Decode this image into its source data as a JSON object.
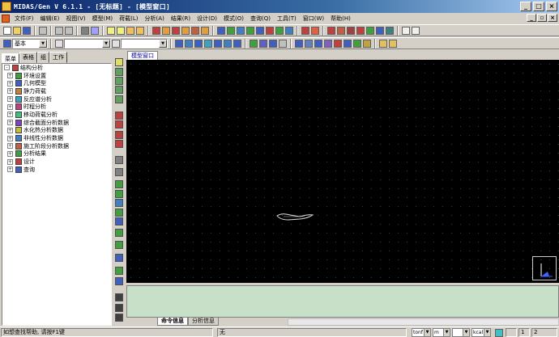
{
  "window": {
    "title": "MIDAS/Gen V 6.1.1 - [无标题] - [模型窗口]"
  },
  "menu": {
    "items": [
      "文件(F)",
      "编辑(E)",
      "视图(V)",
      "模型(M)",
      "荷载(L)",
      "分析(A)",
      "结果(R)",
      "设计(D)",
      "模式(O)",
      "查询(Q)",
      "工具(T)",
      "窗口(W)",
      "帮助(H)"
    ]
  },
  "toolbar2": {
    "unit_combo": "基本",
    "node_combo": ""
  },
  "left_panel": {
    "tabs": [
      "菜单",
      "表格",
      "组",
      "工作"
    ],
    "tree": [
      {
        "label": "结构分析",
        "level": 0,
        "expander": "-",
        "icon_color": "#c04040"
      },
      {
        "label": "环境设置",
        "level": 1,
        "expander": "+",
        "icon_color": "#40a040"
      },
      {
        "label": "几何模型",
        "level": 1,
        "expander": "+",
        "icon_color": "#4060c0"
      },
      {
        "label": "静力荷载",
        "level": 1,
        "expander": "+",
        "icon_color": "#c08040"
      },
      {
        "label": "反应谱分析",
        "level": 1,
        "expander": "+",
        "icon_color": "#40a0c0"
      },
      {
        "label": "时程分析",
        "level": 1,
        "expander": "+",
        "icon_color": "#c04080"
      },
      {
        "label": "移动荷载分析",
        "level": 1,
        "expander": "+",
        "icon_color": "#40c080"
      },
      {
        "label": "综合截面分析数据",
        "level": 1,
        "expander": "+",
        "icon_color": "#8040c0"
      },
      {
        "label": "水化热分析数据",
        "level": 1,
        "expander": "+",
        "icon_color": "#c0c040"
      },
      {
        "label": "非线性分析数据",
        "level": 1,
        "expander": "+",
        "icon_color": "#4080c0"
      },
      {
        "label": "施工阶段分析数据",
        "level": 1,
        "expander": "+",
        "icon_color": "#c06040"
      },
      {
        "label": "分析结果",
        "level": 1,
        "expander": "+",
        "icon_color": "#40a040"
      },
      {
        "label": "设计",
        "level": 1,
        "expander": "+",
        "icon_color": "#c04040"
      },
      {
        "label": "查询",
        "level": 1,
        "expander": "+",
        "icon_color": "#4060c0"
      }
    ]
  },
  "view": {
    "tab_label": "模型窗口"
  },
  "message": {
    "tabs": [
      "命令信息",
      "分析信息"
    ],
    "active_tab": "命令信息"
  },
  "status": {
    "help_text": "如想查找帮助, 请按F1键",
    "selection": "无",
    "unit_force": "tonf",
    "unit_length": "m",
    "unit_temp": "",
    "unit_heat": "kcal",
    "angle": "",
    "page": "1",
    "page_total": "2"
  },
  "colors": {
    "title_start": "#0a246a",
    "title_end": "#a6caf0",
    "canvas_bg": "#000000",
    "message_bg": "#c8e0c8",
    "tree_bg": "#ffffff"
  }
}
